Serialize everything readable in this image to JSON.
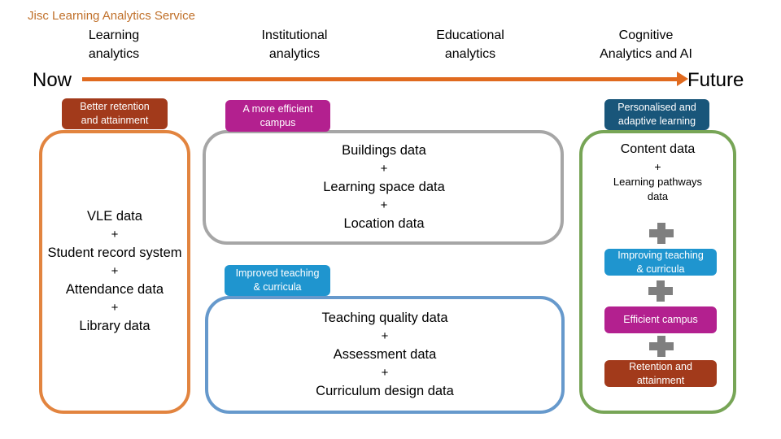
{
  "header": {
    "service_title": "Jisc Learning Analytics Service",
    "stages": [
      {
        "line1": "Learning",
        "line2": "analytics"
      },
      {
        "line1": "Institutional",
        "line2": "analytics"
      },
      {
        "line1": "Educational",
        "line2": "analytics"
      },
      {
        "line1": "Cognitive",
        "line2": "Analytics and AI"
      }
    ]
  },
  "timeline": {
    "start_label": "Now",
    "end_label": "Future",
    "arrow_color": "#e06a1f"
  },
  "columns": {
    "learning": {
      "pill": {
        "line1": "Better retention",
        "line2": "and attainment",
        "color": "#a23a1b"
      },
      "border_color": "#e2843f",
      "items": [
        "VLE data",
        "+",
        "Student record system",
        "+",
        "Attendance data",
        "+",
        "Library data"
      ]
    },
    "campus": {
      "pill": {
        "line1": "A more efficient",
        "line2": "campus",
        "color": "#b3208f"
      },
      "border_color": "#a6a6a6",
      "items": [
        "Buildings data",
        "+",
        "Learning space data",
        "+",
        "Location data"
      ]
    },
    "teaching": {
      "pill": {
        "line1": "Improved teaching",
        "line2": "& curricula",
        "color": "#1f95cf"
      },
      "border_color": "#6699cc",
      "items": [
        "Teaching quality data",
        "+",
        "Assessment data",
        "+",
        "Curriculum design data"
      ]
    },
    "cognitive": {
      "pill": {
        "line1": "Personalised and",
        "line2": "adaptive learning",
        "color": "#19567a"
      },
      "border_color": "#77a556",
      "items": [
        "Content data",
        "+",
        "Learning pathways",
        "data"
      ],
      "stack": [
        {
          "line1": "Improving teaching",
          "line2": "& curricula",
          "color": "#1f95cf"
        },
        {
          "line1": "Efficient campus",
          "line2": "",
          "color": "#b3208f"
        },
        {
          "line1": "Retention and",
          "line2": "attainment",
          "color": "#a23a1b"
        }
      ]
    }
  }
}
